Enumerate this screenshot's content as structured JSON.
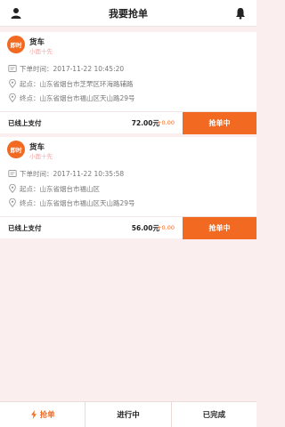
{
  "header": {
    "title": "我要抢单",
    "left_icon": "user-icon",
    "right_icon": "bell-icon"
  },
  "orders": [
    {
      "badge": "即时",
      "vehicle": "货车",
      "note": "小面十先",
      "time": "下单时间：2017-11-22 10:45:20",
      "start": "起点：山东省烟台市芝罘区环海路辅路",
      "end": "终点：山东省烟台市福山区天山路29号",
      "pay_label": "已线上支付",
      "price": "72.00元",
      "bonus": "+0.00",
      "button": "抢单中"
    },
    {
      "badge": "即时",
      "vehicle": "货车",
      "note": "小面十先",
      "time": "下单时间：2017-11-22 10:35:58",
      "start": "起点：山东省烟台市福山区",
      "end": "终点：山东省烟台市福山区天山路29号",
      "pay_label": "已线上支付",
      "price": "56.00元",
      "bonus": "+0.00",
      "button": "抢单中"
    }
  ],
  "tabs": [
    {
      "label": "抢单",
      "icon": "bolt-icon"
    },
    {
      "label": "进行中"
    },
    {
      "label": "已完成"
    }
  ],
  "colors": {
    "accent": "#f26a22",
    "background": "#fbeeee",
    "note": "#f5a3a3"
  }
}
